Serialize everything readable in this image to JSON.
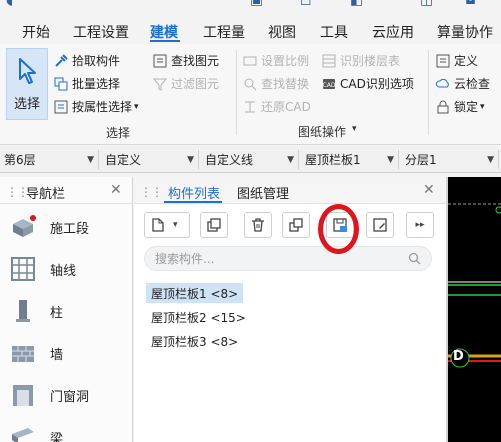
{
  "menu": {
    "items": [
      "开始",
      "工程设置",
      "建模",
      "工程量",
      "视图",
      "工具",
      "云应用",
      "算量协作"
    ],
    "active_index": 2
  },
  "ribbon": {
    "select": {
      "label": "选择"
    },
    "col1": [
      "拾取构件",
      "批量选择",
      "按属性选择"
    ],
    "col2": [
      "查找图元",
      "过滤图元"
    ],
    "col3": [
      "设置比例",
      "查找替换",
      "还原CAD"
    ],
    "col4": [
      "识别楼层表",
      "CAD识别选项"
    ],
    "col5": [
      "定义",
      "云检查",
      "锁定"
    ],
    "group_labels": {
      "select": "选择",
      "drawing_ops": "图纸操作"
    }
  },
  "dropdowns": [
    "第6层",
    "自定义",
    "自定义线",
    "屋顶栏板1",
    "分层1"
  ],
  "nav": {
    "title": "导航栏",
    "items": [
      {
        "label": "施工段",
        "icon": "construction-segment-icon"
      },
      {
        "label": "轴线",
        "icon": "grid-axis-icon"
      },
      {
        "label": "柱",
        "icon": "column-icon"
      },
      {
        "label": "墙",
        "icon": "wall-icon"
      },
      {
        "label": "门窗洞",
        "icon": "door-window-icon"
      },
      {
        "label": "梁",
        "icon": "beam-icon"
      }
    ]
  },
  "panel": {
    "tabs": [
      "构件列表",
      "图纸管理"
    ],
    "search_placeholder": "搜索构件...",
    "components": [
      "屋顶栏板1 <8>",
      "屋顶栏板2 <15>",
      "屋顶栏板3 <8>"
    ],
    "selected_index": 0
  },
  "canvas": {
    "marker_label": "D"
  },
  "colors": {
    "accent": "#1d6fd8",
    "highlight_ring": "#e0141b",
    "selected_row": "#cfe3f6"
  }
}
